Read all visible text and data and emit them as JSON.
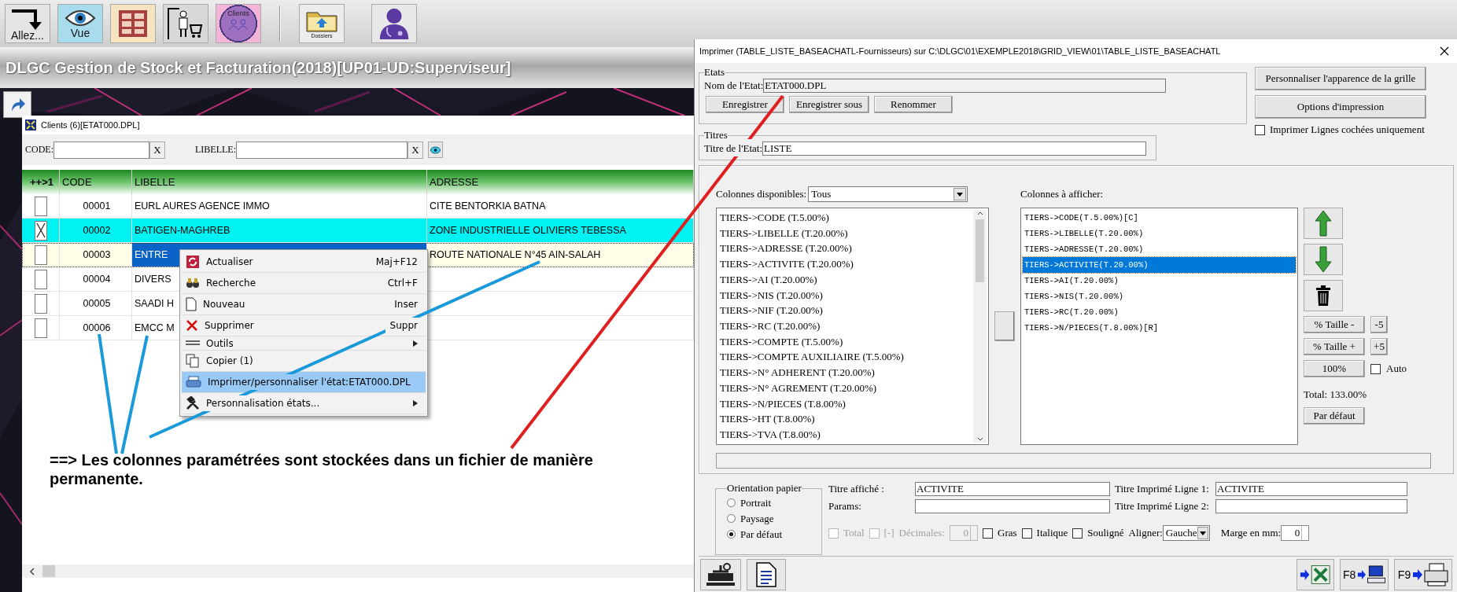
{
  "toolbar": {
    "buttons": [
      {
        "kind": "goto",
        "label": "Allez..."
      },
      {
        "kind": "view",
        "label": "Vue"
      },
      {
        "kind": "grid"
      },
      {
        "kind": "stock"
      },
      {
        "kind": "clients",
        "label": "Clients"
      },
      {
        "kind": "separator"
      },
      {
        "kind": "folder",
        "label": "Dossiers"
      },
      {
        "kind": "user"
      }
    ]
  },
  "app_title": "DLGC Gestion de Stock et Facturation(2018)[UP01-UD:Superviseur]",
  "clients_window": {
    "title": "Clients (6)[ETAT000.DPL]",
    "filters": [
      {
        "label": "CODE:",
        "clear": "X"
      },
      {
        "label": "LIBELLE:",
        "clear": "X"
      }
    ],
    "columns": [
      "++>1",
      "CODE",
      "LIBELLE",
      "ADRESSE"
    ],
    "rows": [
      {
        "checked": false,
        "selected": false,
        "code": "00001",
        "libelle": "EURL AURES AGENCE IMMO",
        "adresse": "CITE BENTORKIA BATNA"
      },
      {
        "checked": true,
        "selected": false,
        "code": "00002",
        "libelle": "BATIGEN-MAGHREB",
        "adresse": "ZONE INDUSTRIELLE OLIVIERS TEBESSA"
      },
      {
        "checked": false,
        "selected": true,
        "code": "00003",
        "libelle": "ENTRE",
        "adresse": "ROUTE NATIONALE N°45 AIN-SALAH"
      },
      {
        "checked": false,
        "selected": false,
        "code": "00004",
        "libelle": "DIVERS"
      },
      {
        "checked": false,
        "selected": false,
        "code": "00005",
        "libelle": "SAADI H"
      },
      {
        "checked": false,
        "selected": false,
        "code": "00006",
        "libelle": "EMCC M"
      }
    ],
    "context_menu": [
      {
        "kind": "refresh",
        "label": "Actualiser",
        "shortcut": "Maj+F12",
        "submenu": false,
        "selected": false
      },
      {
        "kind": "search",
        "label": "Recherche",
        "shortcut": "Ctrl+F",
        "submenu": false,
        "selected": false
      },
      {
        "kind": "new",
        "label": "Nouveau",
        "shortcut": "Inser",
        "submenu": false,
        "selected": false
      },
      {
        "kind": "delete",
        "label": "Supprimer",
        "shortcut": "Suppr",
        "submenu": false,
        "selected": false
      },
      {
        "kind": "tools",
        "label": "Outils",
        "submenu": true,
        "selected": false
      },
      {
        "kind": "copy",
        "label": "Copier (1)",
        "submenu": false,
        "selected": false
      },
      {
        "kind": "print",
        "label": "Imprimer/personnaliser l'état:ETAT000.DPL",
        "submenu": false,
        "selected": true
      },
      {
        "kind": "hammer",
        "label": "Personnalisation états...",
        "submenu": true,
        "selected": false
      }
    ],
    "annotation": "==> Les colonnes paramétrées sont stockées dans un fichier de manière permanente."
  },
  "print_dialog": {
    "title": "Imprimer (TABLE_LISTE_BASEACHATL-Fournisseurs)  sur C:\\DLGC\\01\\EXEMPLE2018\\GRID_VIEW\\01\\TABLE_LISTE_BASEACHATL",
    "etats": {
      "legend": "Etats",
      "name_label": "Nom de l'Etat:",
      "name_value": "ETAT000.DPL",
      "buttons": [
        "Enregistrer",
        "Enregistrer sous",
        "Renommer"
      ]
    },
    "grid_buttons": [
      "Personnaliser l'apparence de la grille",
      "Options d'impression"
    ],
    "print_checked_only": {
      "label": "Imprimer Lignes cochées uniquement",
      "checked": false
    },
    "titres": {
      "legend": "Titres",
      "label": "Titre de l'Etat:",
      "value": "LISTE"
    },
    "available": {
      "label": "Colonnes disponibles:",
      "filter": "Tous",
      "items": [
        "TIERS->CODE  (T.5.00%)",
        "TIERS->LIBELLE  (T.20.00%)",
        "TIERS->ADRESSE  (T.20.00%)",
        "TIERS->ACTIVITE  (T.20.00%)",
        "TIERS->AI  (T.20.00%)",
        "TIERS->NIS  (T.20.00%)",
        "TIERS->NIF  (T.20.00%)",
        "TIERS->RC  (T.20.00%)",
        "TIERS->COMPTE  (T.5.00%)",
        "TIERS->COMPTE AUXILIAIRE  (T.5.00%)",
        "TIERS->N° ADHERENT  (T.20.00%)",
        "TIERS->N° AGREMENT  (T.20.00%)",
        "TIERS->N/PIECES  (T.8.00%)",
        "TIERS->HT  (T.8.00%)",
        "TIERS->TVA  (T.8.00%)"
      ]
    },
    "displayed": {
      "label": "Colonnes à afficher:",
      "items": [
        {
          "text": "TIERS->CODE(T.5.00%)[C]",
          "selected": false
        },
        {
          "text": "TIERS->LIBELLE(T.20.00%)",
          "selected": false
        },
        {
          "text": "TIERS->ADRESSE(T.20.00%)",
          "selected": false
        },
        {
          "text": "TIERS->ACTIVITE(T.20.00%)",
          "selected": true
        },
        {
          "text": "TIERS->AI(T.20.00%)",
          "selected": false
        },
        {
          "text": "TIERS->NIS(T.20.00%)",
          "selected": false
        },
        {
          "text": "TIERS->RC(T.20.00%)",
          "selected": false
        },
        {
          "text": "TIERS->N/PIECES(T.8.00%)[R]",
          "selected": false
        }
      ]
    },
    "size": {
      "minus": "% Taille -",
      "minus_step": "-5",
      "plus": "% Taille +",
      "plus_step": "+5",
      "reset": "100%",
      "auto": {
        "label": "Auto",
        "checked": false
      },
      "total": "Total:  133.00%",
      "default": "Par défaut"
    },
    "orientation": {
      "legend": "Orientation papier",
      "options": [
        {
          "label": "Portrait",
          "selected": false
        },
        {
          "label": "Paysage",
          "selected": false
        },
        {
          "label": "Par défaut",
          "selected": true
        }
      ]
    },
    "fields": [
      {
        "label": "Titre affiché :",
        "value": "ACTIVITE"
      },
      {
        "label": "Titre Imprimé Ligne 1:",
        "value": "ACTIVITE"
      },
      {
        "label": "Params:"
      },
      {
        "label": "Titre Imprimé Ligne 2:"
      }
    ],
    "format": {
      "checks_a": [
        {
          "label": "Total",
          "checked": false,
          "disabled": true
        },
        {
          "label": "[-]",
          "checked": false,
          "disabled": true
        }
      ],
      "decimals": {
        "label": "Décimales:",
        "value": "0",
        "disabled": true
      },
      "checks_b": [
        {
          "label": "Gras",
          "checked": false,
          "disabled": false
        },
        {
          "label": "Italique",
          "checked": false,
          "disabled": false
        },
        {
          "label": "Souligné",
          "checked": false,
          "disabled": false
        }
      ],
      "align": {
        "label": "Aligner:",
        "value": "Gauche"
      },
      "margin": {
        "label": "Marge en mm:",
        "value": "0"
      }
    },
    "bottom_buttons": [
      {
        "kind": "setup"
      },
      {
        "kind": "preview"
      },
      {
        "kind": "spacer"
      },
      {
        "kind": "excel"
      },
      {
        "kind": "screen",
        "label": "F8"
      },
      {
        "kind": "printer",
        "label": "F9"
      }
    ]
  }
}
